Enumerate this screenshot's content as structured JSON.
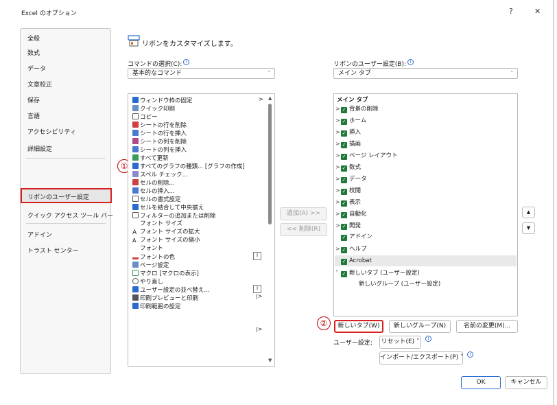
{
  "window": {
    "title": "Excel のオプション",
    "help_glyph": "?",
    "close_glyph": "✕"
  },
  "nav": {
    "items": [
      "全般",
      "数式",
      "データ",
      "文章校正",
      "保存",
      "言語",
      "アクセシビリティ",
      "詳細設定",
      "リボンのユーザー設定",
      "クイック アクセス ツール バー",
      "アドイン",
      "トラスト センター"
    ],
    "selected_index": 8
  },
  "annotations": {
    "badge1": "①",
    "badge2": "②"
  },
  "header": {
    "title": "リボンをカスタマイズします。"
  },
  "left": {
    "label": "コマンドの選択(C):",
    "select_value": "基本的なコマンド",
    "commands": [
      "ウィンドウ枠の固定",
      "クイック印刷",
      "コピー",
      "シートの行を削除",
      "シートの行を挿入",
      "シートの列を削除",
      "シートの列を挿入",
      "すべて更新",
      "すべてのグラフの種類... [グラフの作成]",
      "スペル チェック...",
      "セルの削除...",
      "セルの挿入...",
      "セルの書式設定",
      "セルを結合して中央揃え",
      "フィルターの追加または削除",
      "フォント サイズ",
      "フォント サイズの拡大",
      "フォント サイズの縮小",
      "フォント",
      "フォントの色",
      "ページ設定",
      "マクロ [マクロの表示]",
      "やり直し",
      "ユーザー設定の並べ替え...",
      "印刷プレビューと印刷",
      "印刷範囲の設定"
    ]
  },
  "middle": {
    "add": "追加(A) >>",
    "remove": "<< 削除(R)"
  },
  "right": {
    "label": "リボンのユーザー設定(B):",
    "select_value": "メイン タブ",
    "tree_header": "メイン タブ",
    "tabs": [
      "背景の削除",
      "ホーム",
      "挿入",
      "描画",
      "ページ レイアウト",
      "数式",
      "データ",
      "校閲",
      "表示",
      "自動化",
      "開発",
      "アドイン",
      "ヘルプ",
      "Acrobat",
      "新しいタブ (ユーザー設定)"
    ],
    "new_group": "新しいグループ (ユーザー設定)",
    "buttons": {
      "new_tab": "新しいタブ(W)",
      "new_group": "新しいグループ(N)",
      "rename": "名前の変更(M)..."
    },
    "user_settings_label": "ユーザー設定:",
    "reset": "リセット(E) ˅",
    "import_export": "インポート/エクスポート(P) ˅",
    "up_arrow": "▲",
    "down_arrow": "▼"
  },
  "footer": {
    "ok": "OK",
    "cancel": "キャンセル"
  },
  "colors": {
    "accent_red": "#d62020",
    "check_green": "#1f7a3a",
    "info_blue": "#2a6ad0"
  }
}
